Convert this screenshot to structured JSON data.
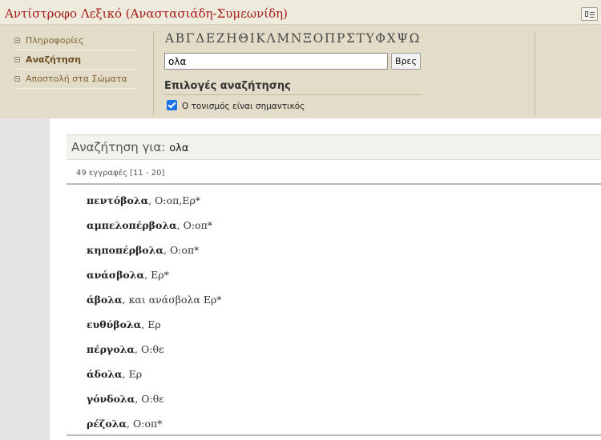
{
  "app": {
    "title": "Αντίστροφο Λεξικό (Αναστασιάδη-Συμεωνίδη)"
  },
  "sidebar": {
    "items": [
      {
        "label": "Πληροφορίες"
      },
      {
        "label": "Αναζήτηση"
      },
      {
        "label": "Αποστολή στα Σώματα"
      }
    ]
  },
  "search": {
    "alphabet": [
      "Α",
      "Β",
      "Γ",
      "Δ",
      "Ε",
      "Ζ",
      "Η",
      "Θ",
      "Ι",
      "Κ",
      "Λ",
      "Μ",
      "Ν",
      "Ξ",
      "Ο",
      "Π",
      "Ρ",
      "Σ",
      "Τ",
      "Υ",
      "Φ",
      "Χ",
      "Ψ",
      "Ω"
    ],
    "query": "ολα",
    "button_label": "Βρες",
    "options_title": "Επιλογές αναζήτησης",
    "accent_option_label": "Ο τονισμός είναι σημαντικός",
    "accent_option_checked": true
  },
  "results": {
    "heading": "Αναζήτηση για:",
    "query": "ολα",
    "count_text": "49 εγγραφές [11 - 20]",
    "entries": [
      {
        "word": "πεντόβολα",
        "rest": ", Ο:οπ,Ερ*"
      },
      {
        "word": "αμπελοπέρβολα",
        "rest": ", Ο:οπ*"
      },
      {
        "word": "κηποπέρβολα",
        "rest": ", Ο:οπ*"
      },
      {
        "word": "ανάσβολα",
        "rest": ", Ερ*"
      },
      {
        "word": "άβολα",
        "rest": ", και ανάσβολα Ερ*"
      },
      {
        "word": "ευθύβολα",
        "rest": ", Ερ"
      },
      {
        "word": "πέργολα",
        "rest": ", Ο:θε"
      },
      {
        "word": "άδολα",
        "rest": ", Ερ"
      },
      {
        "word": "γόνδολα",
        "rest": ", Ο:θε"
      },
      {
        "word": "ρέζολα",
        "rest": ", Ο:οπ*"
      }
    ]
  },
  "colors": {
    "title": "#a61c1c",
    "panel": "#e3dcc8",
    "checkbox": "#1a73e8"
  }
}
